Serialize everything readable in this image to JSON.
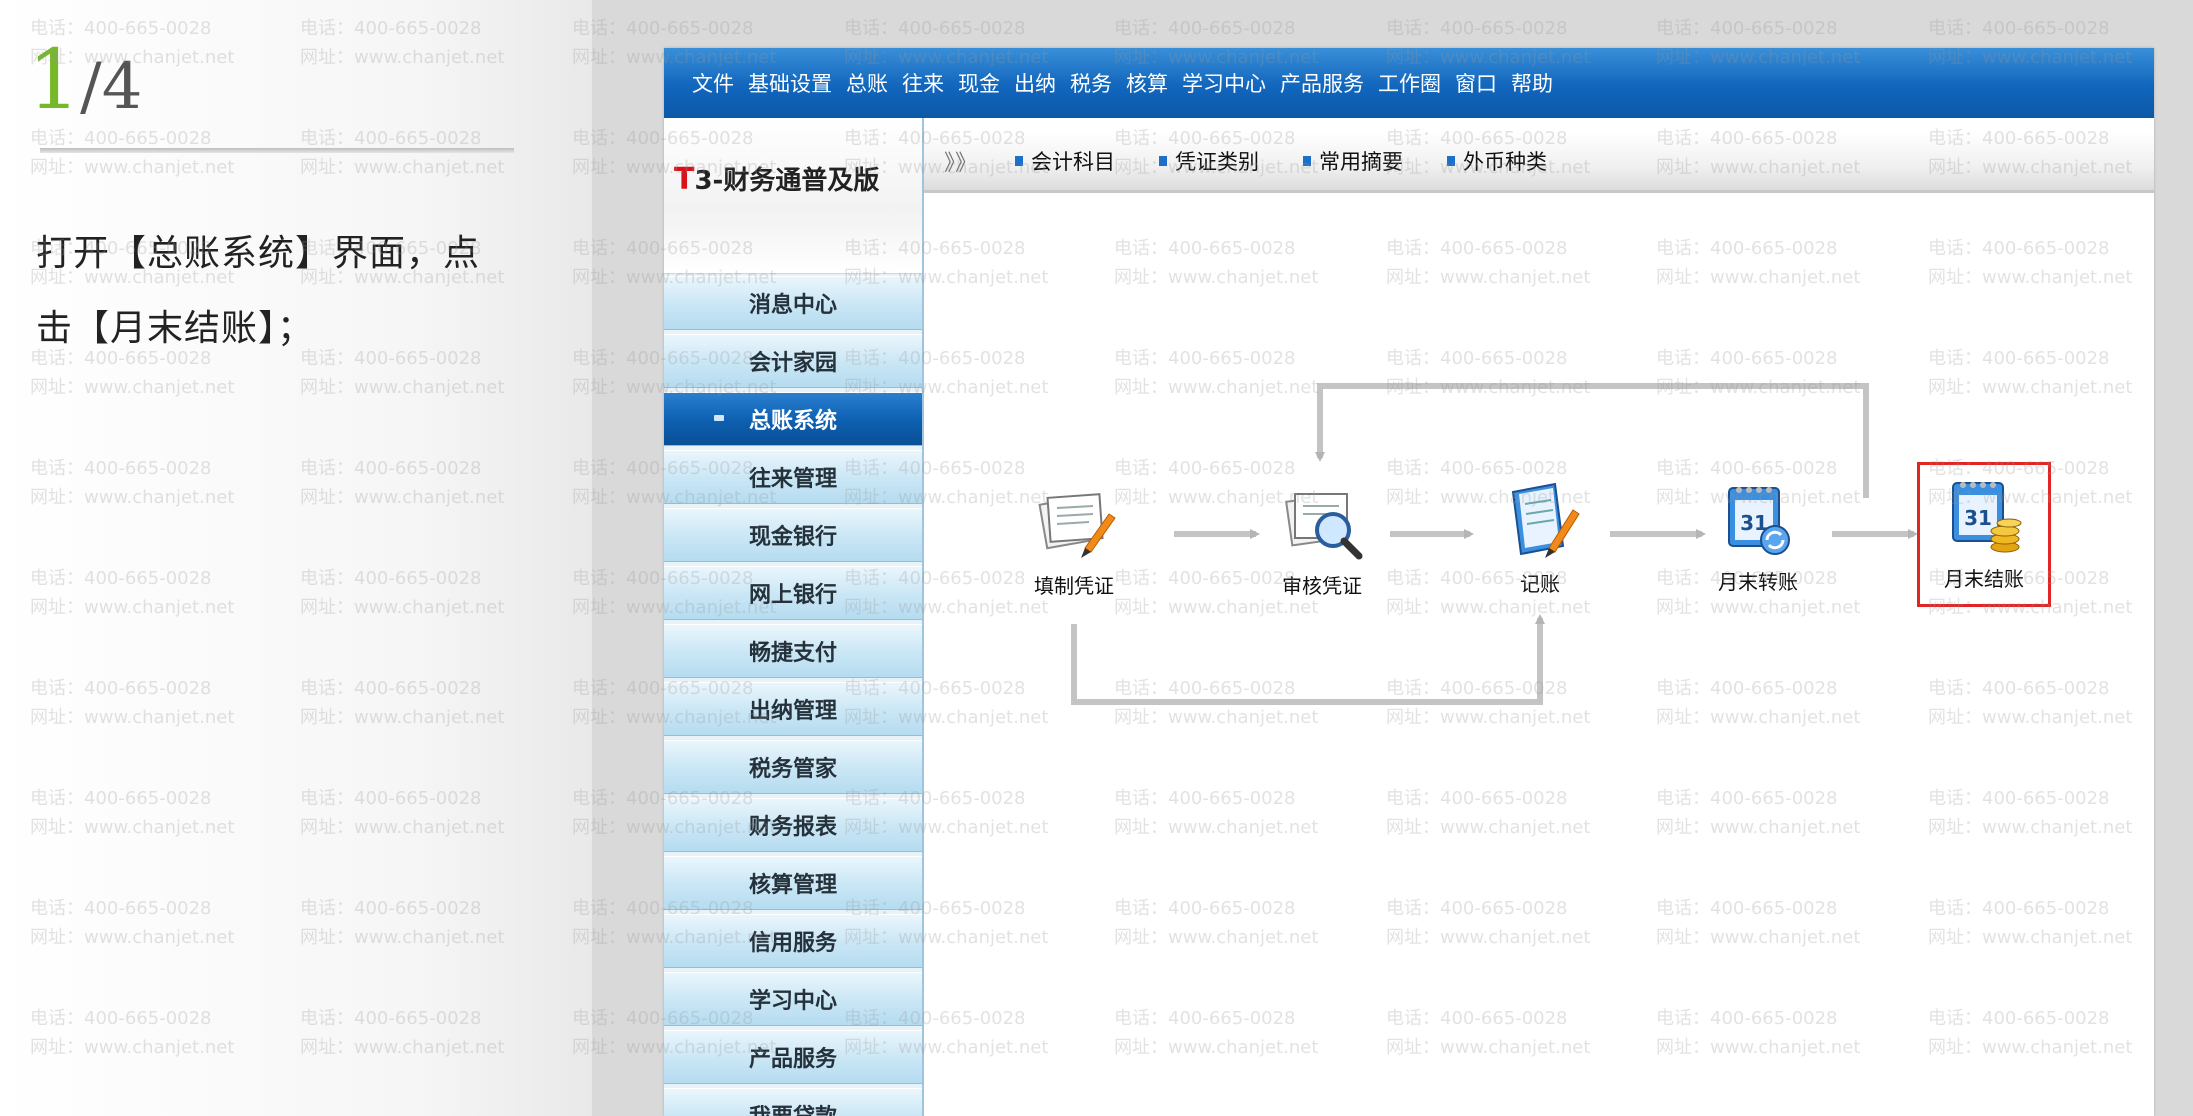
{
  "step": {
    "current": "1",
    "total": "/4"
  },
  "instruction": "打开【总账系统】界面，点击【月末结账】；",
  "menubar": {
    "items": [
      "文件",
      "基础设置",
      "总账",
      "往来",
      "现金",
      "出纳",
      "税务",
      "核算",
      "学习中心",
      "产品服务",
      "工作圈",
      "窗口",
      "帮助"
    ]
  },
  "brand": {
    "prefix": "T",
    "rest": "3-财务通普及版"
  },
  "sidebar": {
    "items": [
      "消息中心",
      "会计家园",
      "总账系统",
      "往来管理",
      "现金银行",
      "网上银行",
      "畅捷支付",
      "出纳管理",
      "税务管家",
      "财务报表",
      "核算管理",
      "信用服务",
      "学习中心",
      "产品服务",
      "我要贷款"
    ],
    "active": "总账系统"
  },
  "toolbar": {
    "chevron": "》》",
    "links": [
      "会计科目",
      "凭证类别",
      "常用摘要",
      "外币种类"
    ]
  },
  "flow": {
    "nodes": [
      "填制凭证",
      "审核凭证",
      "记账",
      "月末转账",
      "月末结账"
    ],
    "highlighted": "月末结账"
  },
  "watermark": {
    "phone": "电话：400-665-0028",
    "site": "网址：www.chanjet.net"
  },
  "colors": {
    "menubar": "#1166bd",
    "highlight": "#e32424",
    "step_accent": "#76b82a"
  }
}
